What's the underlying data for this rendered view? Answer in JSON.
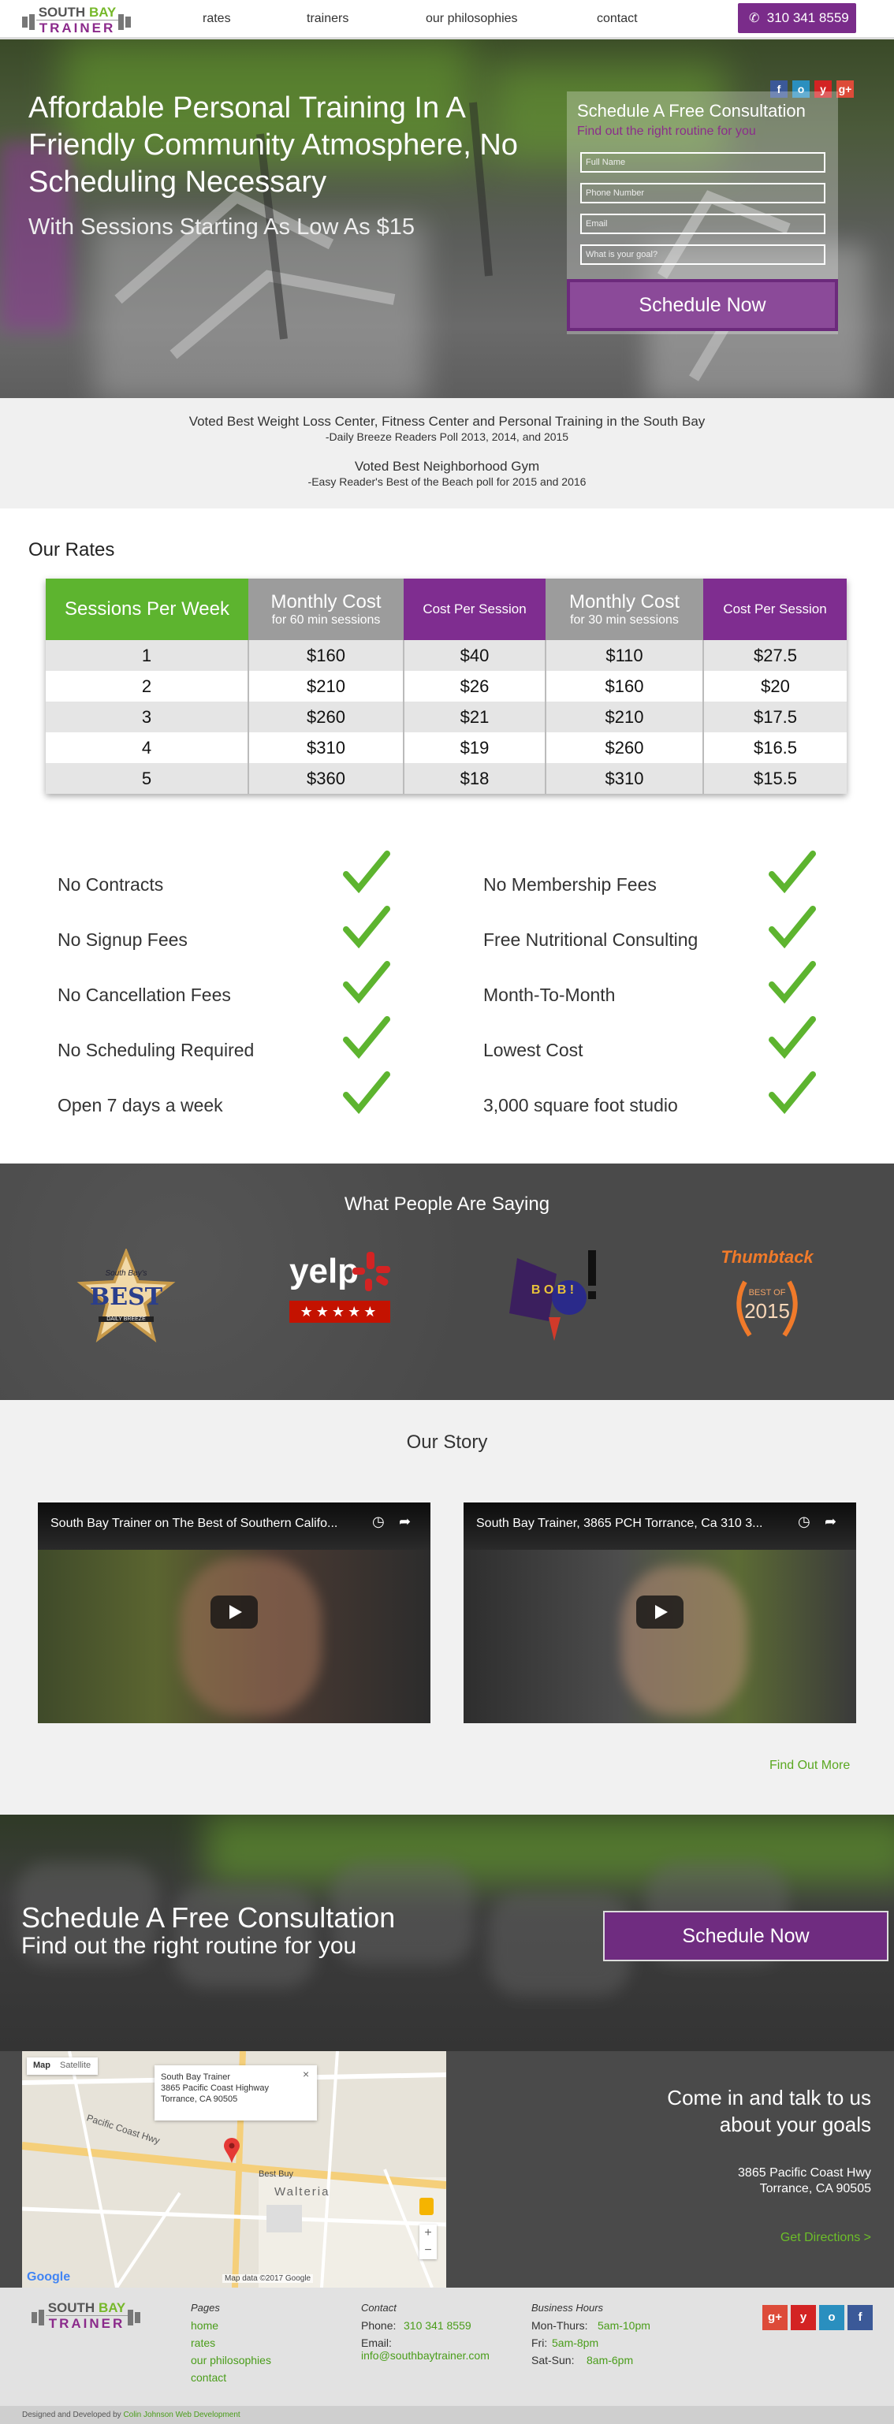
{
  "nav": {
    "logo_top_a": "SOUTH ",
    "logo_top_b": "BAY",
    "logo_bottom": "TRAINER",
    "links": [
      "rates",
      "trainers",
      "our philosophies",
      "contact"
    ],
    "phone": "310 341 8559"
  },
  "hero": {
    "title": "Affordable Personal Training In A Friendly Community Atmosphere, No Scheduling Necessary",
    "subtitle": "With Sessions Starting As Low As $15",
    "social": [
      "f",
      "o",
      "y",
      "g+"
    ],
    "form": {
      "title": "Schedule A Free Consultation",
      "subtitle": "Find out the right routine for you",
      "name_placeholder": "Full Name",
      "phone_placeholder": "Phone Number",
      "email_placeholder": "Email",
      "goals_placeholder": "What is your goal?",
      "button": "Schedule Now"
    }
  },
  "awards": {
    "line1": "Voted Best Weight Loss Center, Fitness Center and Personal Training in the South Bay",
    "line2": "-Daily Breeze Readers Poll 2013, 2014, and 2015",
    "line3": "Voted Best Neighborhood Gym",
    "line4": "-Easy Reader's Best of the Beach poll for 2015 and 2016"
  },
  "rates": {
    "title": "Our Rates",
    "headers": [
      {
        "main": "Sessions Per Week",
        "sub": ""
      },
      {
        "main": "Monthly Cost",
        "sub": "for 60 min sessions"
      },
      {
        "main": "Cost Per Session",
        "sub": ""
      },
      {
        "main": "Monthly Cost",
        "sub": "for 30 min sessions"
      },
      {
        "main": "Cost Per Session",
        "sub": ""
      }
    ],
    "rows": [
      [
        "1",
        "$160",
        "$40",
        "$110",
        "$27.5"
      ],
      [
        "2",
        "$210",
        "$26",
        "$160",
        "$20"
      ],
      [
        "3",
        "$260",
        "$21",
        "$210",
        "$17.5"
      ],
      [
        "4",
        "$310",
        "$19",
        "$260",
        "$16.5"
      ],
      [
        "5",
        "$360",
        "$18",
        "$310",
        "$15.5"
      ]
    ],
    "colors": {
      "green": "#5db42f",
      "gray": "#9c9c9c",
      "purple": "#7f2d90"
    }
  },
  "features": {
    "left": [
      "No Contracts",
      "No Signup Fees",
      "No Cancellation Fees",
      "No Scheduling Required",
      "Open 7 days a week"
    ],
    "right": [
      "No Membership Fees",
      "Free Nutritional Consulting",
      "Month-To-Month",
      "Lowest Cost",
      "3,000 square foot studio"
    ]
  },
  "testimonials": {
    "title": "What People Are Saying",
    "logos": {
      "best_top": "South Bay's",
      "best_word": "BEST",
      "best_bottom": "DAILY BREEZE",
      "yelp": "yelp",
      "bob": "B O B !",
      "thumbtack": "Thumbtack",
      "thumbtack_best": "BEST OF",
      "thumbtack_year": "2015"
    }
  },
  "story": {
    "title": "Our Story",
    "video1": "South Bay Trainer on The Best of Southern Califo...",
    "video2": "South Bay Trainer, 3865 PCH Torrance, Ca 310 3...",
    "find_more": "Find Out More"
  },
  "cta": {
    "title": "Schedule A Free Consultation",
    "subtitle": "Find out the right routine for you",
    "button": "Schedule Now"
  },
  "map": {
    "tab_map": "Map",
    "tab_satellite": "Satellite",
    "popup_name": "South Bay Trainer",
    "popup_addr1": "3865 Pacific Coast Highway",
    "popup_addr2": "Torrance, CA 90505",
    "street_pch": "Pacific Coast Hwy",
    "area_walteria": "Walteria",
    "store": "Best Buy",
    "copyright": "Map data ©2017 Google",
    "google": "Google"
  },
  "contact": {
    "heading1": "Come in and talk to us",
    "heading2": "about your goals",
    "addr1": "3865 Pacific Coast Hwy",
    "addr2": "Torrance, CA 90505",
    "directions": "Get Directions >"
  },
  "footer": {
    "pages_head": "Pages",
    "pages": [
      "home",
      "rates",
      "our philosophies",
      "contact"
    ],
    "contact_head": "Contact",
    "phone_label": "Phone:",
    "phone": "310 341 8559",
    "email_label": "Email:",
    "email": "info@southbaytrainer.com",
    "hours_head": "Business Hours",
    "hours": [
      {
        "day": "Mon-Thurs:",
        "time": "5am-10pm"
      },
      {
        "day": "Fri:",
        "time": "5am-8pm"
      },
      {
        "day": "Sat-Sun:",
        "time": "8am-6pm"
      }
    ],
    "credit_a": "Designed and Developed by",
    "credit_b": "Colin Johnson Web Development"
  }
}
